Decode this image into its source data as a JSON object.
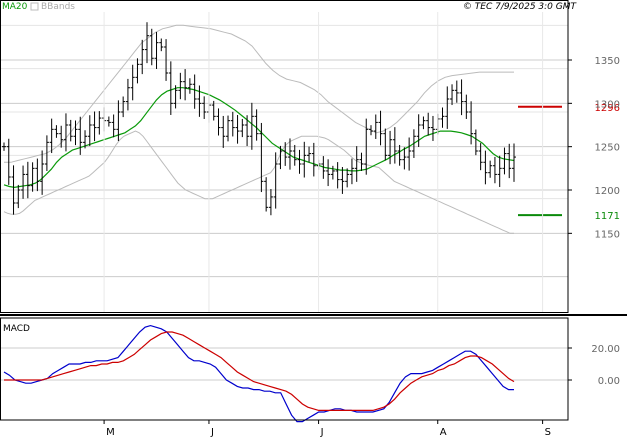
{
  "header": {
    "legend_ma": "MA20",
    "legend_bb": "BBands",
    "source": "© TEC 7/9/2025 3:0 GMT"
  },
  "chart_data": [
    {
      "type": "ohlc",
      "yticks": [
        1150,
        1200,
        1250,
        1300,
        1350
      ],
      "ylim": [
        1100,
        1400
      ],
      "x_labels": [
        "M",
        "J",
        "J",
        "A",
        "S"
      ],
      "x_label_index": [
        21,
        43,
        66,
        91,
        113
      ],
      "levels": [
        {
          "value": 1296,
          "label": "1296",
          "color": "#cc0000"
        },
        {
          "value": 1171,
          "label": "1171",
          "color": "#0a8a0a"
        }
      ],
      "series": {
        "close": [
          1250,
          1215,
          1185,
          1200,
          1218,
          1205,
          1225,
          1210,
          1230,
          1255,
          1270,
          1265,
          1258,
          1275,
          1262,
          1270,
          1255,
          1262,
          1275,
          1272,
          1283,
          1280,
          1278,
          1270,
          1290,
          1302,
          1318,
          1330,
          1345,
          1362,
          1378,
          1352,
          1370,
          1365,
          1335,
          1300,
          1315,
          1325,
          1318,
          1322,
          1305,
          1300,
          1290,
          1298,
          1285,
          1272,
          1262,
          1280,
          1272,
          1268,
          1275,
          1262,
          1285,
          1265,
          1210,
          1180,
          1192,
          1230,
          1245,
          1238,
          1245,
          1235,
          1230,
          1240,
          1242,
          1228,
          1230,
          1222,
          1218,
          1222,
          1212,
          1210,
          1218,
          1225,
          1235,
          1230,
          1270,
          1268,
          1278,
          1265,
          1240,
          1258,
          1245,
          1235,
          1238,
          1245,
          1262,
          1275,
          1280,
          1272,
          1270,
          1282,
          1285,
          1305,
          1315,
          1312,
          1302,
          1290,
          1265,
          1245,
          1232,
          1220,
          1228,
          1218,
          1225,
          1242,
          1225,
          1238
        ],
        "ma20": [
          1206,
          1204,
          1203,
          1204,
          1205,
          1206,
          1208,
          1212,
          1218,
          1224,
          1232,
          1238,
          1242,
          1246,
          1248,
          1250,
          1252,
          1254,
          1256,
          1258,
          1260,
          1262,
          1264,
          1266,
          1270,
          1274,
          1280,
          1288,
          1296,
          1304,
          1310,
          1314,
          1316,
          1318,
          1318,
          1317,
          1316,
          1314,
          1312,
          1310,
          1307,
          1304,
          1300,
          1296,
          1292,
          1287,
          1282,
          1277,
          1272,
          1266,
          1260,
          1254,
          1250,
          1246,
          1242,
          1238,
          1236,
          1234,
          1232,
          1230,
          1228,
          1226,
          1225,
          1224,
          1223,
          1223,
          1222,
          1222,
          1223,
          1224,
          1227,
          1230,
          1233,
          1236,
          1240,
          1243,
          1247,
          1250,
          1254,
          1258,
          1262,
          1264,
          1266,
          1268,
          1268,
          1268,
          1267,
          1266,
          1264,
          1262,
          1258,
          1254,
          1248,
          1242,
          1238,
          1236,
          1235,
          1234
        ],
        "bb_upper": [
          1232,
          1232,
          1234,
          1236,
          1238,
          1240,
          1242,
          1246,
          1252,
          1260,
          1270,
          1280,
          1290,
          1300,
          1310,
          1320,
          1330,
          1340,
          1350,
          1360,
          1370,
          1376,
          1382,
          1386,
          1388,
          1390,
          1390,
          1389,
          1388,
          1387,
          1386,
          1384,
          1382,
          1380,
          1376,
          1372,
          1366,
          1356,
          1346,
          1338,
          1332,
          1328,
          1326,
          1324,
          1320,
          1316,
          1310,
          1302,
          1296,
          1290,
          1284,
          1278,
          1274,
          1270,
          1266,
          1268,
          1272,
          1278,
          1286,
          1294,
          1302,
          1312,
          1320,
          1326,
          1330,
          1332,
          1333,
          1334,
          1335,
          1336,
          1336,
          1336,
          1336,
          1336,
          1336
        ],
        "bb_lower": [
          1175,
          1173,
          1172,
          1172,
          1173,
          1176,
          1180,
          1184,
          1188,
          1190,
          1192,
          1194,
          1196,
          1198,
          1200,
          1202,
          1204,
          1206,
          1208,
          1210,
          1212,
          1214,
          1216,
          1220,
          1224,
          1228,
          1232,
          1238,
          1245,
          1252,
          1258,
          1262,
          1264,
          1266,
          1268,
          1266,
          1262,
          1256,
          1250,
          1244,
          1238,
          1232,
          1226,
          1220,
          1214,
          1208,
          1204,
          1200,
          1198,
          1196,
          1194,
          1192,
          1190,
          1190,
          1190,
          1192,
          1194,
          1196,
          1198,
          1200,
          1202,
          1204,
          1206,
          1208,
          1210,
          1212,
          1214,
          1216,
          1218,
          1220,
          1226,
          1236,
          1246,
          1252,
          1256,
          1258,
          1260,
          1262,
          1262,
          1262,
          1262,
          1262,
          1261,
          1260,
          1258,
          1255,
          1252,
          1249,
          1246,
          1242,
          1238,
          1234,
          1232,
          1230,
          1229,
          1228,
          1227,
          1226,
          1222,
          1218,
          1214,
          1210,
          1208,
          1206,
          1204,
          1202,
          1200,
          1198,
          1196,
          1194,
          1192,
          1190,
          1188,
          1186,
          1184,
          1182,
          1180,
          1178,
          1176,
          1174,
          1172,
          1170,
          1168,
          1166,
          1164,
          1162,
          1160,
          1158,
          1156,
          1154,
          1152,
          1150,
          1150
        ]
      }
    },
    {
      "type": "line",
      "title": "MACD",
      "yticks": [
        0,
        20
      ],
      "ylim": [
        -30,
        40
      ],
      "series": [
        {
          "color": "#0000cc",
          "values": [
            5,
            3,
            0,
            -1,
            -2,
            -2,
            -1,
            0,
            1,
            4,
            6,
            8,
            10,
            10,
            10,
            11,
            11,
            12,
            12,
            12,
            13,
            14,
            18,
            22,
            26,
            30,
            33,
            34,
            33,
            32,
            30,
            26,
            22,
            18,
            14,
            12,
            12,
            11,
            10,
            8,
            4,
            0,
            -2,
            -4,
            -5,
            -5,
            -6,
            -6,
            -7,
            -7,
            -8,
            -8,
            -15,
            -22,
            -26,
            -26,
            -24,
            -22,
            -20,
            -20,
            -19,
            -18,
            -18,
            -19,
            -19,
            -20,
            -20,
            -20,
            -20,
            -19,
            -18,
            -14,
            -8,
            -2,
            2,
            4,
            4,
            4,
            5,
            6,
            8,
            10,
            12,
            14,
            16,
            18,
            18,
            16,
            12,
            8,
            4,
            0,
            -4,
            -6,
            -6
          ]
        },
        {
          "color": "#cc0000",
          "values": [
            0,
            0,
            0,
            0,
            0,
            0,
            0,
            0,
            1,
            2,
            3,
            4,
            5,
            6,
            7,
            8,
            9,
            9,
            10,
            10,
            11,
            11,
            12,
            14,
            16,
            19,
            22,
            25,
            27,
            29,
            30,
            30,
            29,
            28,
            26,
            24,
            22,
            20,
            18,
            16,
            14,
            11,
            8,
            5,
            3,
            1,
            -1,
            -2,
            -3,
            -4,
            -5,
            -6,
            -7,
            -9,
            -12,
            -15,
            -17,
            -18,
            -19,
            -19,
            -19,
            -19,
            -19,
            -19,
            -19,
            -19,
            -19,
            -19,
            -19,
            -18,
            -17,
            -15,
            -12,
            -8,
            -5,
            -2,
            0,
            2,
            3,
            4,
            6,
            7,
            9,
            10,
            12,
            14,
            15,
            15,
            14,
            12,
            10,
            7,
            4,
            1,
            -1
          ]
        }
      ]
    }
  ]
}
